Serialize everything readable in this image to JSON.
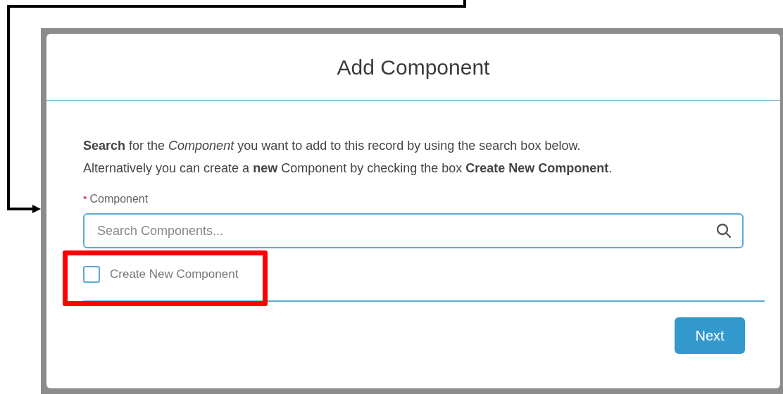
{
  "modal": {
    "title": "Add Component",
    "instructions": [
      "**Search** for the *Component* you want to add to this record by using the search box below.",
      "Alternatively you can create a **new** Component by checking the box **Create New Component**."
    ],
    "field": {
      "required_mark": "*",
      "label": "Component",
      "placeholder": "Search Components..."
    },
    "checkbox": {
      "label": "Create New Component",
      "checked": false
    },
    "buttons": [
      {
        "label": "Next"
      }
    ]
  }
}
